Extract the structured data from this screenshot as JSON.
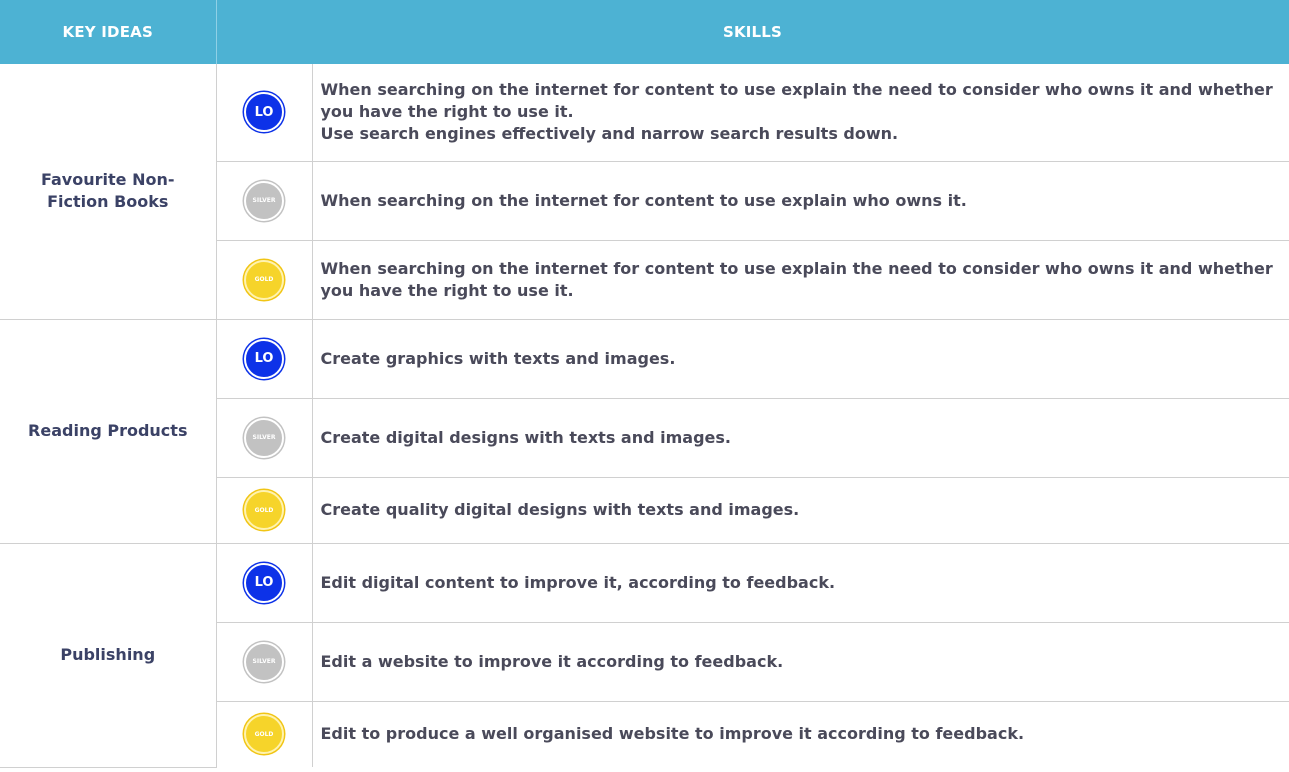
{
  "header": {
    "key_ideas": "KEY IDEAS",
    "skills": "SKILLS"
  },
  "badges": {
    "lo": "LO",
    "silver": "SILVER",
    "gold": "GOLD"
  },
  "colors": {
    "header_bg": "#4db2d3",
    "lo": "#0d32e8",
    "silver": "#c2c2c2",
    "gold": "#f6d42a",
    "text": "#3b4266"
  },
  "groups": [
    {
      "key_idea": "Favourite Non-Fiction Books",
      "rows": [
        {
          "level": "LO",
          "skill": "When searching on the internet for content to use explain the need to consider who owns it and whether you have the right to use it.\nUse search engines effectively and narrow search results down."
        },
        {
          "level": "SILVER",
          "skill": "When searching on the internet for content to use explain who owns it."
        },
        {
          "level": "GOLD",
          "skill": "When searching on the internet for content to use explain the need to consider who owns it and whether you have the right to use it."
        }
      ]
    },
    {
      "key_idea": "Reading Products",
      "rows": [
        {
          "level": "LO",
          "skill": "Create graphics with texts and images."
        },
        {
          "level": "SILVER",
          "skill": "Create digital designs with texts and images."
        },
        {
          "level": "GOLD",
          "skill": "Create quality digital designs with texts and images."
        }
      ]
    },
    {
      "key_idea": "Publishing",
      "rows": [
        {
          "level": "LO",
          "skill": "Edit digital content to improve it, according to feedback."
        },
        {
          "level": "SILVER",
          "skill": "Edit a website to improve it according to feedback."
        },
        {
          "level": "GOLD",
          "skill": "Edit to produce a well organised website to improve it according to feedback."
        }
      ]
    }
  ]
}
